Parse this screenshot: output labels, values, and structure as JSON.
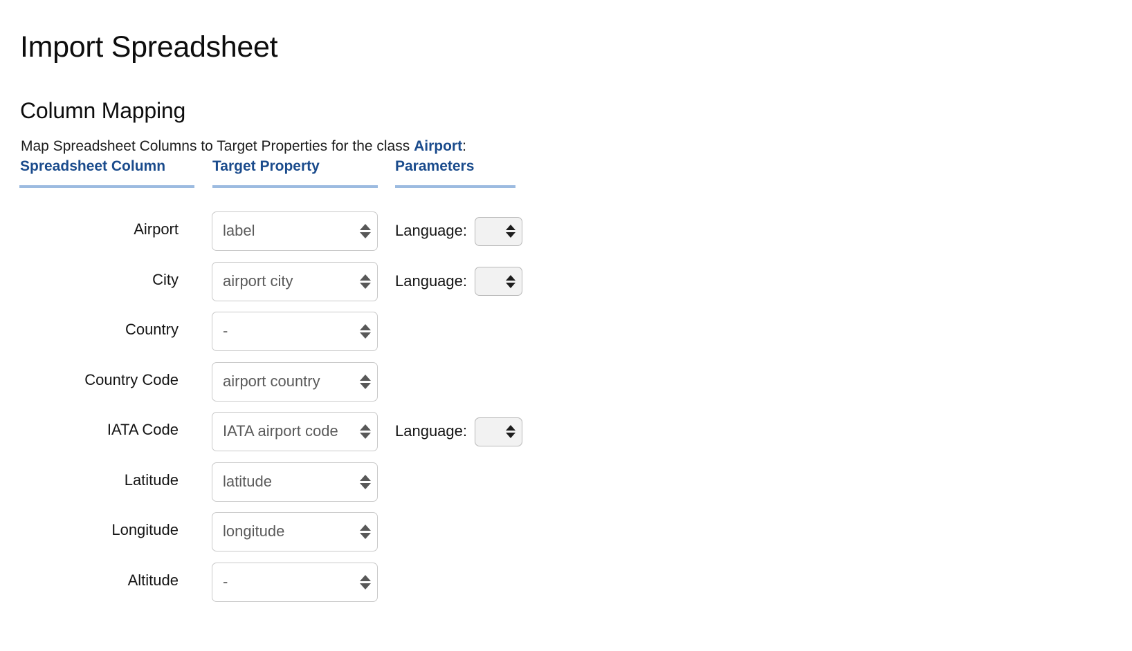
{
  "page": {
    "title": "Import Spreadsheet"
  },
  "section": {
    "heading": "Column Mapping",
    "description_prefix": "Map Spreadsheet Columns to Target Properties for the class ",
    "description_class": "Airport",
    "description_suffix": ":"
  },
  "table": {
    "headers": {
      "spreadsheet_column": "Spreadsheet Column",
      "target_property": "Target Property",
      "parameters": "Parameters"
    },
    "rows": [
      {
        "spreadsheet_column": "Airport",
        "target_property": "label",
        "has_parameter": true,
        "parameter_label": "Language:",
        "parameter_value": ""
      },
      {
        "spreadsheet_column": "City",
        "target_property": "airport city",
        "has_parameter": true,
        "parameter_label": "Language:",
        "parameter_value": ""
      },
      {
        "spreadsheet_column": "Country",
        "target_property": "-",
        "has_parameter": false,
        "parameter_label": "",
        "parameter_value": ""
      },
      {
        "spreadsheet_column": "Country Code",
        "target_property": "airport country",
        "has_parameter": false,
        "parameter_label": "",
        "parameter_value": ""
      },
      {
        "spreadsheet_column": "IATA Code",
        "target_property": "IATA airport code",
        "has_parameter": true,
        "parameter_label": "Language:",
        "parameter_value": ""
      },
      {
        "spreadsheet_column": "Latitude",
        "target_property": "latitude",
        "has_parameter": false,
        "parameter_label": "",
        "parameter_value": ""
      },
      {
        "spreadsheet_column": "Longitude",
        "target_property": "longitude",
        "has_parameter": false,
        "parameter_label": "",
        "parameter_value": ""
      },
      {
        "spreadsheet_column": "Altitude",
        "target_property": "-",
        "has_parameter": false,
        "parameter_label": "",
        "parameter_value": ""
      }
    ]
  },
  "colors": {
    "heading_blue": "#1a4b8c",
    "underline_blue": "#9cbbe0",
    "select_border": "#c9c9c9",
    "select_text": "#5a5a5a",
    "lang_select_bg": "#f2f2f2",
    "page_background": "#ffffff",
    "body_text": "#141414"
  }
}
